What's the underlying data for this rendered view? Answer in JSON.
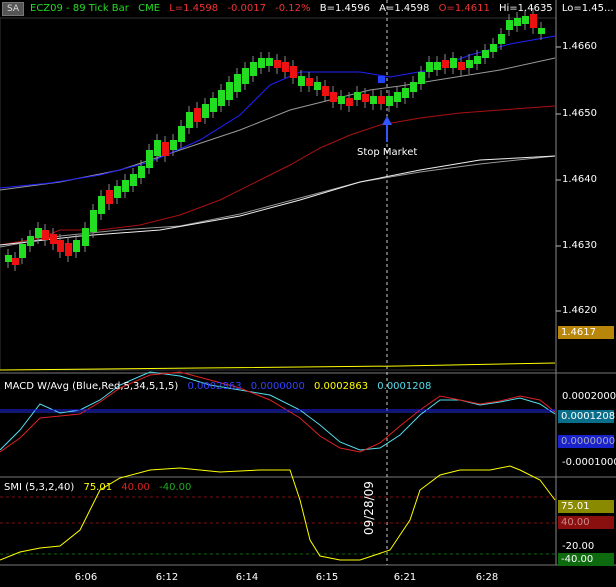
{
  "badge": "SA",
  "header": {
    "symbol": "ECZ09 - 89 Tick Bar",
    "exchange": "CME",
    "last": "L=1.4598",
    "change": "-0.0017",
    "change_pct": "-0.12%",
    "bid": "B=1.4596",
    "ask": "A=1.4598",
    "open": "O=1.4611",
    "high": "Hi=1.4635",
    "low": "Lo=1.45..."
  },
  "price_axis": {
    "ticks": [
      "1.4660",
      "1.4650",
      "1.4640",
      "1.4630",
      "1.4620"
    ],
    "current_box": "1.4617"
  },
  "annotation": {
    "stop_label": "Stop Market"
  },
  "macd": {
    "title": "MACD W/Avg (Blue,Red,5,34,5,1,5)",
    "v1": "0.0002863",
    "v2": "0.0000000",
    "v3": "0.0002863",
    "v4": "0.0001208",
    "ticks": [
      "0.0002000",
      "-0.0001000"
    ],
    "box_cyan": "0.0001208",
    "box_blue": "0.0000000"
  },
  "smi": {
    "title": "SMI (5,3,2,40)",
    "v1": "75.01",
    "v2": "40.00",
    "v3": "-40.00",
    "ticks": [
      "-20.00"
    ],
    "box_yellow": "75.01",
    "box_red": "40.00",
    "box_green": "-40.00"
  },
  "date_marker": "09/28/09",
  "x_axis": [
    "6:06",
    "6:12",
    "6:14",
    "6:15",
    "6:21",
    "6:28"
  ],
  "colors": {
    "up": "#22dd22",
    "down": "#ee1111",
    "bb_mid": "#2222ff",
    "ma_gray": "#999999",
    "bb_low": "#aa1111",
    "ma_white": "#eeeeee",
    "yellow": "#ffff00",
    "macd_blue": "#2222ff",
    "macd_cyan": "#55ddee",
    "macd_red": "#dd2222",
    "smi_yellow": "#ffff00"
  }
}
